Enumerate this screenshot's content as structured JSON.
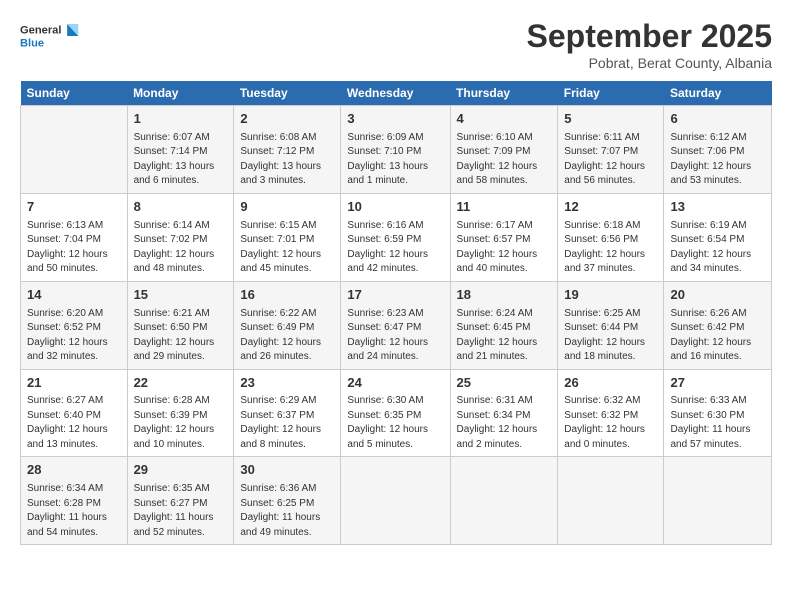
{
  "logo": {
    "line1": "General",
    "line2": "Blue"
  },
  "title": "September 2025",
  "subtitle": "Pobrat, Berat County, Albania",
  "days_header": [
    "Sunday",
    "Monday",
    "Tuesday",
    "Wednesday",
    "Thursday",
    "Friday",
    "Saturday"
  ],
  "weeks": [
    [
      {
        "num": "",
        "sunrise": "",
        "sunset": "",
        "daylight": "",
        "empty": true
      },
      {
        "num": "1",
        "sunrise": "Sunrise: 6:07 AM",
        "sunset": "Sunset: 7:14 PM",
        "daylight": "Daylight: 13 hours and 6 minutes."
      },
      {
        "num": "2",
        "sunrise": "Sunrise: 6:08 AM",
        "sunset": "Sunset: 7:12 PM",
        "daylight": "Daylight: 13 hours and 3 minutes."
      },
      {
        "num": "3",
        "sunrise": "Sunrise: 6:09 AM",
        "sunset": "Sunset: 7:10 PM",
        "daylight": "Daylight: 13 hours and 1 minute."
      },
      {
        "num": "4",
        "sunrise": "Sunrise: 6:10 AM",
        "sunset": "Sunset: 7:09 PM",
        "daylight": "Daylight: 12 hours and 58 minutes."
      },
      {
        "num": "5",
        "sunrise": "Sunrise: 6:11 AM",
        "sunset": "Sunset: 7:07 PM",
        "daylight": "Daylight: 12 hours and 56 minutes."
      },
      {
        "num": "6",
        "sunrise": "Sunrise: 6:12 AM",
        "sunset": "Sunset: 7:06 PM",
        "daylight": "Daylight: 12 hours and 53 minutes."
      }
    ],
    [
      {
        "num": "7",
        "sunrise": "Sunrise: 6:13 AM",
        "sunset": "Sunset: 7:04 PM",
        "daylight": "Daylight: 12 hours and 50 minutes."
      },
      {
        "num": "8",
        "sunrise": "Sunrise: 6:14 AM",
        "sunset": "Sunset: 7:02 PM",
        "daylight": "Daylight: 12 hours and 48 minutes."
      },
      {
        "num": "9",
        "sunrise": "Sunrise: 6:15 AM",
        "sunset": "Sunset: 7:01 PM",
        "daylight": "Daylight: 12 hours and 45 minutes."
      },
      {
        "num": "10",
        "sunrise": "Sunrise: 6:16 AM",
        "sunset": "Sunset: 6:59 PM",
        "daylight": "Daylight: 12 hours and 42 minutes."
      },
      {
        "num": "11",
        "sunrise": "Sunrise: 6:17 AM",
        "sunset": "Sunset: 6:57 PM",
        "daylight": "Daylight: 12 hours and 40 minutes."
      },
      {
        "num": "12",
        "sunrise": "Sunrise: 6:18 AM",
        "sunset": "Sunset: 6:56 PM",
        "daylight": "Daylight: 12 hours and 37 minutes."
      },
      {
        "num": "13",
        "sunrise": "Sunrise: 6:19 AM",
        "sunset": "Sunset: 6:54 PM",
        "daylight": "Daylight: 12 hours and 34 minutes."
      }
    ],
    [
      {
        "num": "14",
        "sunrise": "Sunrise: 6:20 AM",
        "sunset": "Sunset: 6:52 PM",
        "daylight": "Daylight: 12 hours and 32 minutes."
      },
      {
        "num": "15",
        "sunrise": "Sunrise: 6:21 AM",
        "sunset": "Sunset: 6:50 PM",
        "daylight": "Daylight: 12 hours and 29 minutes."
      },
      {
        "num": "16",
        "sunrise": "Sunrise: 6:22 AM",
        "sunset": "Sunset: 6:49 PM",
        "daylight": "Daylight: 12 hours and 26 minutes."
      },
      {
        "num": "17",
        "sunrise": "Sunrise: 6:23 AM",
        "sunset": "Sunset: 6:47 PM",
        "daylight": "Daylight: 12 hours and 24 minutes."
      },
      {
        "num": "18",
        "sunrise": "Sunrise: 6:24 AM",
        "sunset": "Sunset: 6:45 PM",
        "daylight": "Daylight: 12 hours and 21 minutes."
      },
      {
        "num": "19",
        "sunrise": "Sunrise: 6:25 AM",
        "sunset": "Sunset: 6:44 PM",
        "daylight": "Daylight: 12 hours and 18 minutes."
      },
      {
        "num": "20",
        "sunrise": "Sunrise: 6:26 AM",
        "sunset": "Sunset: 6:42 PM",
        "daylight": "Daylight: 12 hours and 16 minutes."
      }
    ],
    [
      {
        "num": "21",
        "sunrise": "Sunrise: 6:27 AM",
        "sunset": "Sunset: 6:40 PM",
        "daylight": "Daylight: 12 hours and 13 minutes."
      },
      {
        "num": "22",
        "sunrise": "Sunrise: 6:28 AM",
        "sunset": "Sunset: 6:39 PM",
        "daylight": "Daylight: 12 hours and 10 minutes."
      },
      {
        "num": "23",
        "sunrise": "Sunrise: 6:29 AM",
        "sunset": "Sunset: 6:37 PM",
        "daylight": "Daylight: 12 hours and 8 minutes."
      },
      {
        "num": "24",
        "sunrise": "Sunrise: 6:30 AM",
        "sunset": "Sunset: 6:35 PM",
        "daylight": "Daylight: 12 hours and 5 minutes."
      },
      {
        "num": "25",
        "sunrise": "Sunrise: 6:31 AM",
        "sunset": "Sunset: 6:34 PM",
        "daylight": "Daylight: 12 hours and 2 minutes."
      },
      {
        "num": "26",
        "sunrise": "Sunrise: 6:32 AM",
        "sunset": "Sunset: 6:32 PM",
        "daylight": "Daylight: 12 hours and 0 minutes."
      },
      {
        "num": "27",
        "sunrise": "Sunrise: 6:33 AM",
        "sunset": "Sunset: 6:30 PM",
        "daylight": "Daylight: 11 hours and 57 minutes."
      }
    ],
    [
      {
        "num": "28",
        "sunrise": "Sunrise: 6:34 AM",
        "sunset": "Sunset: 6:28 PM",
        "daylight": "Daylight: 11 hours and 54 minutes."
      },
      {
        "num": "29",
        "sunrise": "Sunrise: 6:35 AM",
        "sunset": "Sunset: 6:27 PM",
        "daylight": "Daylight: 11 hours and 52 minutes."
      },
      {
        "num": "30",
        "sunrise": "Sunrise: 6:36 AM",
        "sunset": "Sunset: 6:25 PM",
        "daylight": "Daylight: 11 hours and 49 minutes."
      },
      {
        "num": "",
        "sunrise": "",
        "sunset": "",
        "daylight": "",
        "empty": true
      },
      {
        "num": "",
        "sunrise": "",
        "sunset": "",
        "daylight": "",
        "empty": true
      },
      {
        "num": "",
        "sunrise": "",
        "sunset": "",
        "daylight": "",
        "empty": true
      },
      {
        "num": "",
        "sunrise": "",
        "sunset": "",
        "daylight": "",
        "empty": true
      }
    ]
  ]
}
